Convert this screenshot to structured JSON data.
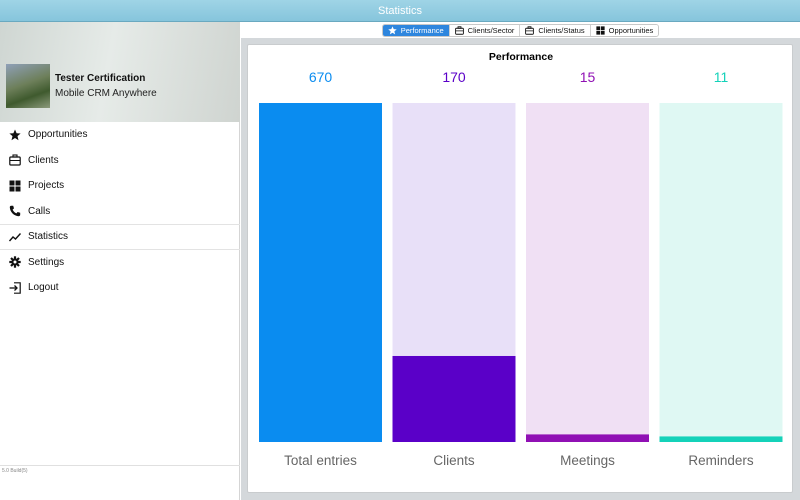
{
  "window": {
    "title": "Statistics"
  },
  "profile": {
    "name": "Tester Certification",
    "subtitle": "Mobile CRM Anywhere"
  },
  "sidebar": {
    "items": [
      {
        "label": "Opportunities",
        "icon": "star-icon"
      },
      {
        "label": "Clients",
        "icon": "briefcase-icon"
      },
      {
        "label": "Projects",
        "icon": "grid-icon"
      },
      {
        "label": "Calls",
        "icon": "phone-icon"
      },
      {
        "label": "Statistics",
        "icon": "chart-line-icon",
        "active": true
      },
      {
        "label": "Settings",
        "icon": "gear-icon"
      },
      {
        "label": "Logout",
        "icon": "logout-icon"
      }
    ],
    "build": "5.0 Build(5)"
  },
  "tabs": [
    {
      "label": "Performance",
      "icon": "star-icon",
      "active": true
    },
    {
      "label": "Clients/Sector",
      "icon": "briefcase-icon"
    },
    {
      "label": "Clients/Status",
      "icon": "briefcase-icon"
    },
    {
      "label": "Opportunities",
      "icon": "grid-icon"
    }
  ],
  "card": {
    "title": "Performance"
  },
  "colors": {
    "accent": "#2e86de",
    "titlebar": "#8fcbe0"
  },
  "chart_data": {
    "type": "bar",
    "title": "Performance",
    "categories": [
      "Total entries",
      "Clients",
      "Meetings",
      "Reminders"
    ],
    "values": [
      670,
      170,
      15,
      11
    ],
    "ylim": [
      0,
      670
    ],
    "colors": [
      "#0a8cf0",
      "#5a00c8",
      "#9010b4",
      "#14d2b9"
    ],
    "track_colors": [
      "#0a8cf0",
      "#e8e0f8",
      "#f0e0f4",
      "#dff8f3"
    ],
    "value_colors": [
      "#0a8cf0",
      "#5a00c8",
      "#9010b4",
      "#14d2b9"
    ],
    "grid": false,
    "legend": "none"
  }
}
